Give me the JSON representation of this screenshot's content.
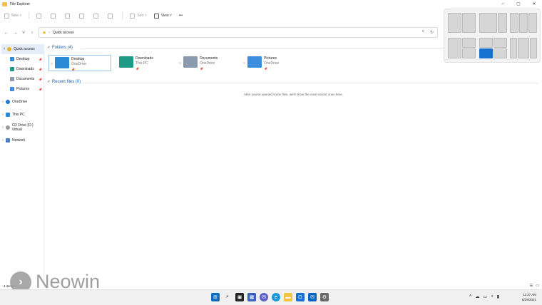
{
  "window": {
    "title": "File Explorer",
    "controls": [
      "–",
      "▢",
      "✕"
    ]
  },
  "toolbar": {
    "new_label": "New",
    "sort_label": "Sort",
    "view_label": "View",
    "more_label": "•••"
  },
  "address": {
    "path": "Quick access",
    "separator": "›"
  },
  "sidebar": {
    "quick_access": "Quick access",
    "pinned": [
      {
        "label": "Desktop"
      },
      {
        "label": "Downloads"
      },
      {
        "label": "Documents"
      },
      {
        "label": "Pictures"
      }
    ],
    "onedrive": "OneDrive",
    "this_pc": "This PC",
    "cd_drive": "CD Drive (D:) Virtual",
    "network": "Network"
  },
  "content": {
    "folders_header": "Folders (4)",
    "recent_header": "Recent files (0)",
    "empty_message": "After you've opened some files, we'll show the most recent ones here.",
    "folders": [
      {
        "name": "Desktop",
        "location": "OneDrive"
      },
      {
        "name": "Downloads",
        "location": "This PC"
      },
      {
        "name": "Documents",
        "location": "OneDrive"
      },
      {
        "name": "Pictures",
        "location": "OneDrive"
      }
    ]
  },
  "status": {
    "item_count": "4 items"
  },
  "watermark": {
    "brand": "Neowin"
  },
  "clock": {
    "time": "11:37 AM",
    "date": "8/29/2021"
  },
  "colors": {
    "accent": "#1570cf",
    "folder_yellow": "#f3c341",
    "link_blue": "#1c5fa8"
  }
}
